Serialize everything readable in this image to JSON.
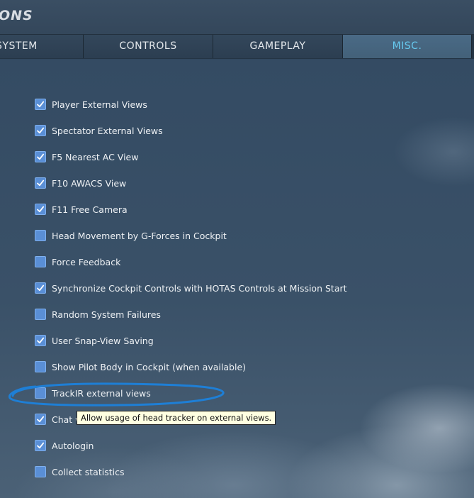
{
  "header": {
    "title": "ONS"
  },
  "tabs": [
    {
      "label": "SYSTEM",
      "active": false
    },
    {
      "label": "CONTROLS",
      "active": false
    },
    {
      "label": "GAMEPLAY",
      "active": false
    },
    {
      "label": "MISC.",
      "active": true
    }
  ],
  "options": [
    {
      "label": "Player External Views",
      "checked": true
    },
    {
      "label": "Spectator External Views",
      "checked": true
    },
    {
      "label": "F5 Nearest AC View",
      "checked": true
    },
    {
      "label": "F10 AWACS View",
      "checked": true
    },
    {
      "label": "F11 Free Camera",
      "checked": true
    },
    {
      "label": "Head Movement by G-Forces in Cockpit",
      "checked": false
    },
    {
      "label": "Force Feedback",
      "checked": false
    },
    {
      "label": "Synchronize Cockpit Controls with HOTAS Controls at Mission Start",
      "checked": true
    },
    {
      "label": "Random System Failures",
      "checked": false
    },
    {
      "label": "User Snap-View Saving",
      "checked": true
    },
    {
      "label": "Show Pilot Body in Cockpit (when available)",
      "checked": false
    },
    {
      "label": "TrackIR external views",
      "checked": false
    },
    {
      "label": "Chat window",
      "checked": true
    },
    {
      "label": "Autologin",
      "checked": true
    },
    {
      "label": "Collect statistics",
      "checked": false
    }
  ],
  "tooltip": {
    "text": "Allow usage of head tracker on external views."
  },
  "colors": {
    "checkbox": "#5a8fd6",
    "active_tab_text": "#66c9ef",
    "annotation_ellipse": "#1e7fd6"
  }
}
